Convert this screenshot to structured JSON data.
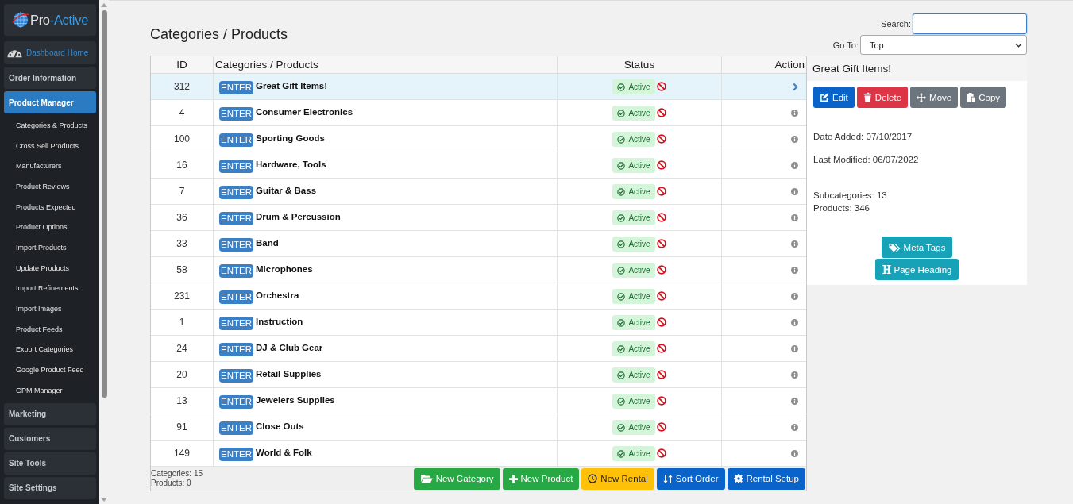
{
  "sidebar": {
    "logo": {
      "parts": [
        "Pro",
        "-Active"
      ]
    },
    "items": [
      {
        "label": "Dashboard Home",
        "kind": "link",
        "selected": false
      },
      {
        "label": "Order Information",
        "kind": "section",
        "selected": false
      },
      {
        "label": "Product Manager",
        "kind": "section",
        "selected": true,
        "children": [
          {
            "label": "Categories & Products"
          },
          {
            "label": "Cross Sell Products"
          },
          {
            "label": "Manufacturers"
          },
          {
            "label": "Product Reviews"
          },
          {
            "label": "Products Expected"
          },
          {
            "label": "Product Options"
          },
          {
            "label": "Import Products"
          },
          {
            "label": "Update Products"
          },
          {
            "label": "Import Refinements"
          },
          {
            "label": "Import Images"
          },
          {
            "label": "Product Feeds"
          },
          {
            "label": "Export Categories"
          },
          {
            "label": "Google Product Feed"
          },
          {
            "label": "GPM Manager"
          }
        ]
      },
      {
        "label": "Marketing",
        "kind": "section",
        "selected": false
      },
      {
        "label": "Customers",
        "kind": "section",
        "selected": false
      },
      {
        "label": "Site Tools",
        "kind": "section",
        "selected": false
      },
      {
        "label": "Site Settings",
        "kind": "section",
        "selected": false
      }
    ]
  },
  "page": {
    "title": "Categories / Products"
  },
  "search": {
    "label": "Search:",
    "focused": true
  },
  "goto": {
    "label": "Go To:",
    "value": "Top"
  },
  "table": {
    "columns": [
      "ID",
      "Categories / Products",
      "Status",
      "Action"
    ],
    "rows": [
      {
        "id": "312",
        "button": "ENTER",
        "name": "Great Gift Items!",
        "status": "Active",
        "selected": true
      },
      {
        "id": "4",
        "button": "ENTER",
        "name": "Consumer Electronics",
        "status": "Active",
        "selected": false
      },
      {
        "id": "100",
        "button": "ENTER",
        "name": "Sporting Goods",
        "status": "Active",
        "selected": false
      },
      {
        "id": "16",
        "button": "ENTER",
        "name": "Hardware, Tools",
        "status": "Active",
        "selected": false
      },
      {
        "id": "7",
        "button": "ENTER",
        "name": "Guitar & Bass",
        "status": "Active",
        "selected": false
      },
      {
        "id": "36",
        "button": "ENTER",
        "name": "Drum & Percussion",
        "status": "Active",
        "selected": false
      },
      {
        "id": "33",
        "button": "ENTER",
        "name": "Band",
        "status": "Active",
        "selected": false
      },
      {
        "id": "58",
        "button": "ENTER",
        "name": "Microphones",
        "status": "Active",
        "selected": false
      },
      {
        "id": "231",
        "button": "ENTER",
        "name": "Orchestra",
        "status": "Active",
        "selected": false
      },
      {
        "id": "1",
        "button": "ENTER",
        "name": "Instruction",
        "status": "Active",
        "selected": false
      },
      {
        "id": "24",
        "button": "ENTER",
        "name": "DJ & Club Gear",
        "status": "Active",
        "selected": false
      },
      {
        "id": "20",
        "button": "ENTER",
        "name": "Retail Supplies",
        "status": "Active",
        "selected": false
      },
      {
        "id": "13",
        "button": "ENTER",
        "name": "Jewelers Supplies",
        "status": "Active",
        "selected": false
      },
      {
        "id": "91",
        "button": "ENTER",
        "name": "Close Outs",
        "status": "Active",
        "selected": false
      },
      {
        "id": "149",
        "button": "ENTER",
        "name": "World & Folk",
        "status": "Active",
        "selected": false
      }
    ],
    "footer": {
      "categories": "Categories: 15",
      "products": "Products: 0",
      "buttons": [
        {
          "label": "New Category",
          "kind": "success"
        },
        {
          "label": "New Product",
          "kind": "success"
        },
        {
          "label": "New Rental",
          "kind": "warning"
        },
        {
          "label": "Sort Order",
          "kind": "primary"
        },
        {
          "label": "Rental Setup",
          "kind": "primary"
        }
      ]
    }
  },
  "detail_panel": {
    "title": "Great Gift Items!",
    "actions": [
      {
        "label": "Edit",
        "kind": "primary"
      },
      {
        "label": "Delete",
        "kind": "danger"
      },
      {
        "label": "Move",
        "kind": "secondary"
      },
      {
        "label": "Copy",
        "kind": "secondary"
      }
    ],
    "date_added": "Date Added: 07/10/2017",
    "last_modified": "Last Modified: 06/07/2022",
    "subcategories": "Subcategories: 13",
    "products": "Products: 346",
    "extra_buttons": [
      {
        "label": "Meta Tags",
        "kind": "info"
      },
      {
        "label": "Page Heading",
        "kind": "info"
      }
    ]
  }
}
